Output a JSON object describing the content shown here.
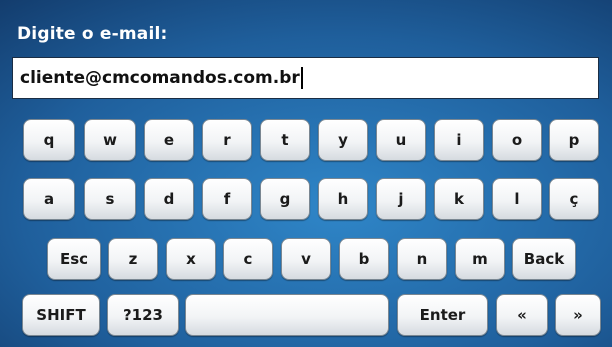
{
  "prompt": "Digite o e-mail:",
  "email": {
    "value": "cliente@cmcomandos.com.br"
  },
  "keyboard": {
    "row1": [
      "q",
      "w",
      "e",
      "r",
      "t",
      "y",
      "u",
      "i",
      "o",
      "p"
    ],
    "row2": [
      "a",
      "s",
      "d",
      "f",
      "g",
      "h",
      "j",
      "k",
      "l",
      "ç"
    ],
    "row3": {
      "esc": "Esc",
      "letters": [
        "z",
        "x",
        "c",
        "v",
        "b",
        "n",
        "m"
      ],
      "back": "Back"
    },
    "row4": {
      "shift": "SHIFT",
      "numbers": "?123",
      "space": "",
      "enter": "Enter",
      "left": "«",
      "right": "»"
    }
  }
}
